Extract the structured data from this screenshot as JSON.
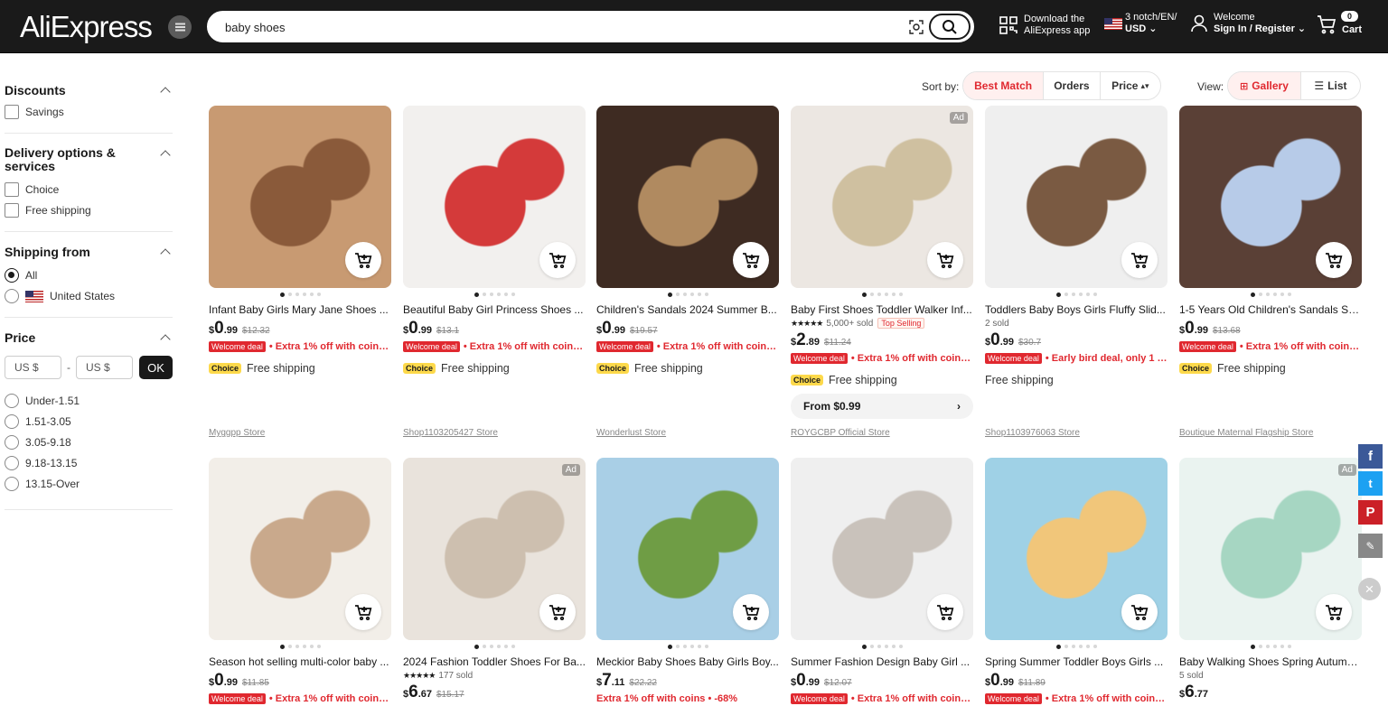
{
  "header": {
    "logo": "AliExpress",
    "search_value": "baby shoes",
    "app_line1": "Download the",
    "app_line2": "AliExpress app",
    "locale_line1": "3 notch/EN/",
    "locale_line2": "USD",
    "account_line1": "Welcome",
    "account_line2": "Sign In / Register",
    "cart_count": "0",
    "cart_label": "Cart"
  },
  "filters": {
    "discounts": {
      "title": "Discounts",
      "options": [
        "Savings"
      ]
    },
    "delivery": {
      "title": "Delivery options & services",
      "options": [
        "Choice",
        "Free shipping"
      ]
    },
    "shipping_from": {
      "title": "Shipping from",
      "options": [
        "All",
        "United States"
      ],
      "selected": "All"
    },
    "price": {
      "title": "Price",
      "min_placeholder": "US $",
      "max_placeholder": "US $",
      "dash": "-",
      "ok": "OK",
      "ranges": [
        "Under-1.51",
        "1.51-3.05",
        "3.05-9.18",
        "9.18-13.15",
        "13.15-Over"
      ]
    }
  },
  "sort": {
    "label": "Sort by:",
    "options": [
      "Best Match",
      "Orders",
      "Price"
    ],
    "active": "Best Match",
    "view_label": "View:",
    "views": [
      "Gallery",
      "List"
    ],
    "active_view": "Gallery"
  },
  "products": [
    {
      "title": "Infant Baby Girls Mary Jane Shoes ...",
      "meta": "",
      "cur": "$",
      "int": "0",
      "dec": ".99",
      "old": "$12.32",
      "badge": "Welcome deal",
      "deal": "• Extra 1% off with coins...",
      "choice": "Choice",
      "ship": "Free shipping",
      "store": "Myggpp Store",
      "ad": ""
    },
    {
      "title": "Beautiful Baby Girl Princess Shoes ...",
      "meta": "",
      "cur": "$",
      "int": "0",
      "dec": ".99",
      "old": "$13.1",
      "badge": "Welcome deal",
      "deal": "• Extra 1% off with coins...",
      "choice": "Choice",
      "ship": "Free shipping",
      "store": "Shop1103205427 Store",
      "ad": ""
    },
    {
      "title": "Children's Sandals 2024 Summer B...",
      "meta": "",
      "cur": "$",
      "int": "0",
      "dec": ".99",
      "old": "$19.57",
      "badge": "Welcome deal",
      "deal": "• Extra 1% off with coins...",
      "choice": "Choice",
      "ship": "Free shipping",
      "store": "Wonderlust Store",
      "ad": ""
    },
    {
      "title": "Baby First Shoes Toddler Walker Inf...",
      "stars": "★★★★★",
      "meta": "5,000+ sold",
      "tag": "Top Selling",
      "cur": "$",
      "int": "2",
      "dec": ".89",
      "old": "$11.24",
      "badge": "Welcome deal",
      "deal": "• Extra 1% off with coins...",
      "choice": "Choice",
      "ship": "Free shipping",
      "from": "From $0.99",
      "store": "ROYGCBP Official Store",
      "ad": "Ad"
    },
    {
      "title": "Toddlers Baby Boys Girls Fluffy Slid...",
      "meta": "2 sold",
      "cur": "$",
      "int": "0",
      "dec": ".99",
      "old": "$30.7",
      "badge": "Welcome deal",
      "deal": "• Early bird deal, only 1 le...",
      "choice": "",
      "ship": "Free shipping",
      "store": "Shop1103976063 Store",
      "ad": ""
    },
    {
      "title": "1-5 Years Old Children's Sandals Su...",
      "meta": "",
      "cur": "$",
      "int": "0",
      "dec": ".99",
      "old": "$13.68",
      "badge": "Welcome deal",
      "deal": "• Extra 1% off with coins...",
      "choice": "Choice",
      "ship": "Free shipping",
      "store": "Boutique Maternal Flagship Store",
      "ad": ""
    },
    {
      "title": "Season hot selling multi-color baby ...",
      "meta": "",
      "cur": "$",
      "int": "0",
      "dec": ".99",
      "old": "$11.85",
      "badge": "Welcome deal",
      "deal": "• Extra 1% off with coins...",
      "ad": ""
    },
    {
      "title": "2024 Fashion Toddler Shoes For Ba...",
      "stars": "★★★★★",
      "meta": "177 sold",
      "cur": "$",
      "int": "6",
      "dec": ".67",
      "old": "$15.17",
      "badge": "",
      "deal": "",
      "ad": "Ad"
    },
    {
      "title": "Meckior Baby Shoes Baby Girls Boy...",
      "meta": "",
      "cur": "$",
      "int": "7",
      "dec": ".11",
      "old": "$22.22",
      "badge": "",
      "deal": "Extra 1% off with coins • -68%",
      "ad": ""
    },
    {
      "title": "Summer Fashion Design Baby Girl ...",
      "meta": "",
      "cur": "$",
      "int": "0",
      "dec": ".99",
      "old": "$12.07",
      "badge": "Welcome deal",
      "deal": "• Extra 1% off with coins...",
      "ad": ""
    },
    {
      "title": "Spring Summer Toddler Boys Girls ...",
      "meta": "",
      "cur": "$",
      "int": "0",
      "dec": ".99",
      "old": "$11.89",
      "badge": "Welcome deal",
      "deal": "• Extra 1% off with coins...",
      "ad": ""
    },
    {
      "title": "Baby Walking Shoes Spring Autumn...",
      "meta": "5 sold",
      "cur": "$",
      "int": "6",
      "dec": ".77",
      "old": "",
      "badge": "",
      "deal": "",
      "ad": "Ad"
    }
  ],
  "colors": {
    "accent": "#e0282f",
    "header_bg": "#1a1a1a",
    "choice": "#fdd94b"
  }
}
